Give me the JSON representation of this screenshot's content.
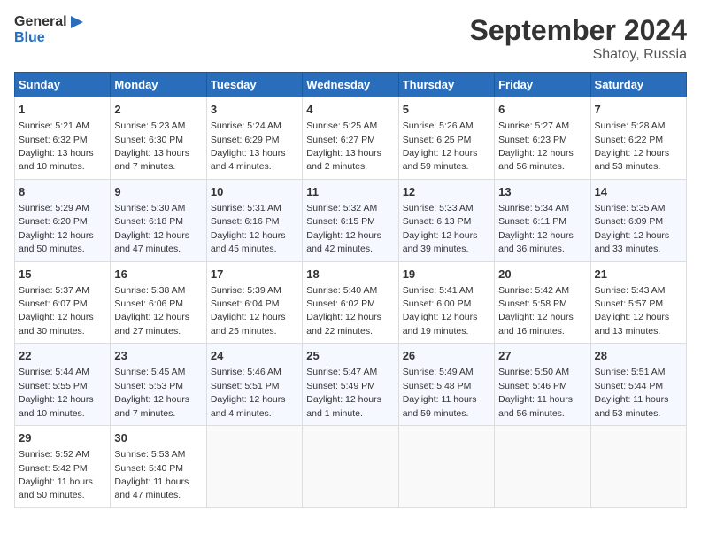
{
  "header": {
    "logo_line1": "General",
    "logo_line2": "Blue",
    "month_title": "September 2024",
    "location": "Shatoy, Russia"
  },
  "weekdays": [
    "Sunday",
    "Monday",
    "Tuesday",
    "Wednesday",
    "Thursday",
    "Friday",
    "Saturday"
  ],
  "weeks": [
    [
      {
        "day": "1",
        "info": "Sunrise: 5:21 AM\nSunset: 6:32 PM\nDaylight: 13 hours and 10 minutes."
      },
      {
        "day": "2",
        "info": "Sunrise: 5:23 AM\nSunset: 6:30 PM\nDaylight: 13 hours and 7 minutes."
      },
      {
        "day": "3",
        "info": "Sunrise: 5:24 AM\nSunset: 6:29 PM\nDaylight: 13 hours and 4 minutes."
      },
      {
        "day": "4",
        "info": "Sunrise: 5:25 AM\nSunset: 6:27 PM\nDaylight: 13 hours and 2 minutes."
      },
      {
        "day": "5",
        "info": "Sunrise: 5:26 AM\nSunset: 6:25 PM\nDaylight: 12 hours and 59 minutes."
      },
      {
        "day": "6",
        "info": "Sunrise: 5:27 AM\nSunset: 6:23 PM\nDaylight: 12 hours and 56 minutes."
      },
      {
        "day": "7",
        "info": "Sunrise: 5:28 AM\nSunset: 6:22 PM\nDaylight: 12 hours and 53 minutes."
      }
    ],
    [
      {
        "day": "8",
        "info": "Sunrise: 5:29 AM\nSunset: 6:20 PM\nDaylight: 12 hours and 50 minutes."
      },
      {
        "day": "9",
        "info": "Sunrise: 5:30 AM\nSunset: 6:18 PM\nDaylight: 12 hours and 47 minutes."
      },
      {
        "day": "10",
        "info": "Sunrise: 5:31 AM\nSunset: 6:16 PM\nDaylight: 12 hours and 45 minutes."
      },
      {
        "day": "11",
        "info": "Sunrise: 5:32 AM\nSunset: 6:15 PM\nDaylight: 12 hours and 42 minutes."
      },
      {
        "day": "12",
        "info": "Sunrise: 5:33 AM\nSunset: 6:13 PM\nDaylight: 12 hours and 39 minutes."
      },
      {
        "day": "13",
        "info": "Sunrise: 5:34 AM\nSunset: 6:11 PM\nDaylight: 12 hours and 36 minutes."
      },
      {
        "day": "14",
        "info": "Sunrise: 5:35 AM\nSunset: 6:09 PM\nDaylight: 12 hours and 33 minutes."
      }
    ],
    [
      {
        "day": "15",
        "info": "Sunrise: 5:37 AM\nSunset: 6:07 PM\nDaylight: 12 hours and 30 minutes."
      },
      {
        "day": "16",
        "info": "Sunrise: 5:38 AM\nSunset: 6:06 PM\nDaylight: 12 hours and 27 minutes."
      },
      {
        "day": "17",
        "info": "Sunrise: 5:39 AM\nSunset: 6:04 PM\nDaylight: 12 hours and 25 minutes."
      },
      {
        "day": "18",
        "info": "Sunrise: 5:40 AM\nSunset: 6:02 PM\nDaylight: 12 hours and 22 minutes."
      },
      {
        "day": "19",
        "info": "Sunrise: 5:41 AM\nSunset: 6:00 PM\nDaylight: 12 hours and 19 minutes."
      },
      {
        "day": "20",
        "info": "Sunrise: 5:42 AM\nSunset: 5:58 PM\nDaylight: 12 hours and 16 minutes."
      },
      {
        "day": "21",
        "info": "Sunrise: 5:43 AM\nSunset: 5:57 PM\nDaylight: 12 hours and 13 minutes."
      }
    ],
    [
      {
        "day": "22",
        "info": "Sunrise: 5:44 AM\nSunset: 5:55 PM\nDaylight: 12 hours and 10 minutes."
      },
      {
        "day": "23",
        "info": "Sunrise: 5:45 AM\nSunset: 5:53 PM\nDaylight: 12 hours and 7 minutes."
      },
      {
        "day": "24",
        "info": "Sunrise: 5:46 AM\nSunset: 5:51 PM\nDaylight: 12 hours and 4 minutes."
      },
      {
        "day": "25",
        "info": "Sunrise: 5:47 AM\nSunset: 5:49 PM\nDaylight: 12 hours and 1 minute."
      },
      {
        "day": "26",
        "info": "Sunrise: 5:49 AM\nSunset: 5:48 PM\nDaylight: 11 hours and 59 minutes."
      },
      {
        "day": "27",
        "info": "Sunrise: 5:50 AM\nSunset: 5:46 PM\nDaylight: 11 hours and 56 minutes."
      },
      {
        "day": "28",
        "info": "Sunrise: 5:51 AM\nSunset: 5:44 PM\nDaylight: 11 hours and 53 minutes."
      }
    ],
    [
      {
        "day": "29",
        "info": "Sunrise: 5:52 AM\nSunset: 5:42 PM\nDaylight: 11 hours and 50 minutes."
      },
      {
        "day": "30",
        "info": "Sunrise: 5:53 AM\nSunset: 5:40 PM\nDaylight: 11 hours and 47 minutes."
      },
      null,
      null,
      null,
      null,
      null
    ]
  ]
}
